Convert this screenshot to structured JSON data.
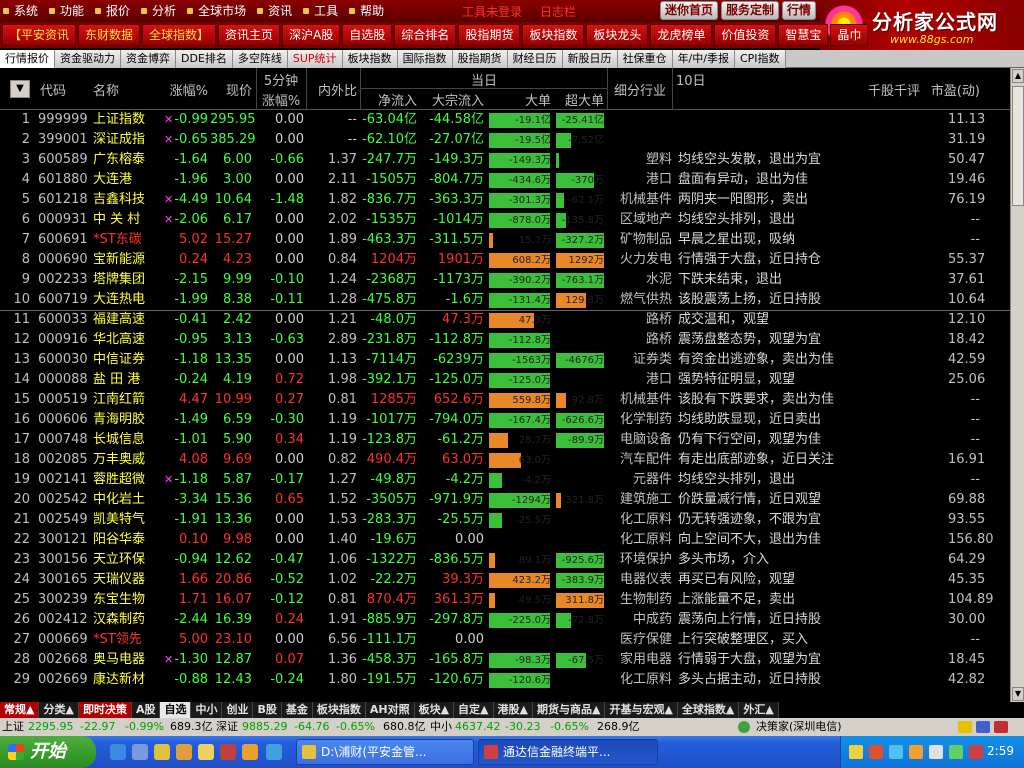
{
  "menu": {
    "items": [
      "系统",
      "功能",
      "报价",
      "分析",
      "全球市场",
      "资讯",
      "工具",
      "帮助"
    ],
    "center_texts": [
      "工具未登录",
      "日志栏"
    ],
    "right_buttons": [
      "迷你首页",
      "服务定制",
      "行情"
    ]
  },
  "logo": {
    "title": "分析家公式网",
    "url": "www.88gs.com"
  },
  "toolbar": [
    "【平安资讯",
    "东财数据",
    "全球指数】",
    "资讯主页",
    "深沪A股",
    "自选股",
    "综合排名",
    "股指期货",
    "板块指数",
    "板块龙头",
    "龙虎榜单",
    "价值投资",
    "智慧宝",
    "晶巾"
  ],
  "tabs": [
    "行情报价",
    "资金驱动力",
    "资金博弈",
    "DDE排名",
    "多空阵线",
    "SUP统计",
    "板块指数",
    "国际指数",
    "股指期货",
    "财经日历",
    "新股日历",
    "社保重仓",
    "年/中/季报",
    "CPI指数"
  ],
  "header": {
    "idx_icon": "▼",
    "code": "代码",
    "name": "名称",
    "chg": "涨幅%",
    "price": "现价",
    "m5_top": "5分钟",
    "m5_bottom": "涨幅%",
    "ratio": "内外比",
    "day": "当日",
    "netin": "净流入",
    "bigin": "大宗流入",
    "big": "大单",
    "superbig": "超大单",
    "industry": "细分行业",
    "tenday": "10日",
    "comment": "千股千评",
    "pe": "市盈(动)"
  },
  "rows": [
    {
      "idx": "1",
      "code": "999999",
      "name": "上证指数",
      "star": true,
      "chg": "-0.99",
      "price": "295.95",
      "m5": "0.00",
      "ratio": "--",
      "netin": "-63.04亿",
      "bigin": "-44.58亿",
      "b1": {
        "v": "-19.1亿",
        "c": "g",
        "w": 0.95
      },
      "b2": {
        "v": "-25.41亿",
        "c": "g",
        "w": 0.95
      },
      "ind": "",
      "comment": "",
      "pe": "11.13",
      "cc": "d"
    },
    {
      "idx": "2",
      "code": "399001",
      "name": "深证成指",
      "star": true,
      "chg": "-0.65",
      "price": "385.29",
      "m5": "0.00",
      "ratio": "--",
      "netin": "-62.10亿",
      "bigin": "-27.07亿",
      "b1": {
        "v": "-19.5亿",
        "c": "g",
        "w": 0.95
      },
      "b2": {
        "v": "-7.52亿",
        "c": "g",
        "w": 0.3
      },
      "ind": "",
      "comment": "",
      "pe": "31.19",
      "cc": "d"
    },
    {
      "idx": "3",
      "code": "600589",
      "name": "广东榕泰",
      "chg": "-1.64",
      "price": "6.00",
      "m5": "-0.66",
      "ratio": "1.37",
      "netin": "-247.7万",
      "bigin": "-149.3万",
      "b1": {
        "v": "-149.3万",
        "c": "g",
        "w": 0.95
      },
      "b2": {
        "v": "",
        "c": "g",
        "w": 0.05
      },
      "ind": "塑料",
      "comment": "均线空头发散，退出为宜",
      "pe": "50.47",
      "cc": "d"
    },
    {
      "idx": "4",
      "code": "601880",
      "name": "大连港",
      "chg": "-1.96",
      "price": "3.00",
      "m5": "0.00",
      "ratio": "2.11",
      "netin": "-1505万",
      "bigin": "-804.7万",
      "b1": {
        "v": "-434.6万",
        "c": "g",
        "w": 0.95
      },
      "b2": {
        "v": "-370万",
        "c": "g",
        "w": 0.75
      },
      "ind": "港口",
      "comment": "盘面有异动，退出为佳",
      "pe": "19.46",
      "cc": "d"
    },
    {
      "idx": "5",
      "code": "601218",
      "name": "吉鑫科技",
      "star": true,
      "chg": "-4.49",
      "price": "10.64",
      "m5": "-1.48",
      "ratio": "1.82",
      "netin": "-836.7万",
      "bigin": "-363.3万",
      "b1": {
        "v": "-301.3万",
        "c": "g",
        "w": 0.95
      },
      "b2": {
        "v": "-62.1万",
        "c": "g",
        "w": 0.15
      },
      "ind": "机械基件",
      "comment": "两阴夹一阳图形，卖出",
      "pe": "76.19",
      "cc": "d"
    },
    {
      "idx": "6",
      "code": "000931",
      "name": "中 关 村",
      "star": true,
      "chg": "-2.06",
      "price": "6.17",
      "m5": "0.00",
      "ratio": "2.02",
      "netin": "-1535万",
      "bigin": "-1014万",
      "b1": {
        "v": "-878.0万",
        "c": "g",
        "w": 0.95
      },
      "b2": {
        "v": "-135.8万",
        "c": "g",
        "w": 0.2
      },
      "ind": "区域地产",
      "comment": "均线空头排列，退出",
      "pe": "--",
      "cc": "d"
    },
    {
      "idx": "7",
      "code": "600691",
      "name": "*ST东碳",
      "red": true,
      "chg": "5.02",
      "price": "15.27",
      "m5": "0.00",
      "ratio": "1.89",
      "netin": "-463.3万",
      "bigin": "-311.5万",
      "b1": {
        "v": "15.7万",
        "c": "o",
        "w": 0.06
      },
      "b2": {
        "v": "-327.2万",
        "c": "g",
        "w": 0.95
      },
      "ind": "矿物制品",
      "comment": "早晨之星出现，吸纳",
      "pe": "--",
      "cc": "u"
    },
    {
      "idx": "8",
      "code": "000690",
      "name": "宝新能源",
      "chg": "0.24",
      "price": "4.23",
      "m5": "0.00",
      "ratio": "0.84",
      "netin": "1204万",
      "bigin": "1901万",
      "b1": {
        "v": "608.2万",
        "c": "o",
        "w": 0.95
      },
      "b2": {
        "v": "1292万",
        "c": "o",
        "w": 0.95
      },
      "ind": "火力发电",
      "comment": "行情强于大盘，近日持仓",
      "pe": "55.37",
      "cc": "u"
    },
    {
      "idx": "9",
      "code": "002233",
      "name": "塔牌集团",
      "chg": "-2.15",
      "price": "9.99",
      "m5": "-0.10",
      "ratio": "1.24",
      "netin": "-2368万",
      "bigin": "-1173万",
      "b1": {
        "v": "-390.2万",
        "c": "g",
        "w": 0.95
      },
      "b2": {
        "v": "-763.1万",
        "c": "g",
        "w": 0.95
      },
      "ind": "水泥",
      "comment": "下跌未结束，退出",
      "pe": "37.61",
      "cc": "d"
    },
    {
      "idx": "10",
      "code": "600719",
      "name": "大连热电",
      "chg": "-1.99",
      "price": "8.38",
      "m5": "-0.11",
      "ratio": "1.28",
      "netin": "-475.8万",
      "bigin": "-1.6万",
      "b1": {
        "v": "-131.4万",
        "c": "g",
        "w": 0.95
      },
      "b2": {
        "v": "129.8万",
        "c": "o",
        "w": 0.6
      },
      "ind": "燃气供热",
      "comment": "该股震荡上扬，近日持股",
      "pe": "10.64",
      "cc": "d"
    },
    {
      "idx": "11",
      "code": "600033",
      "name": "福建高速",
      "chg": "-0.41",
      "price": "2.42",
      "m5": "0.00",
      "ratio": "1.21",
      "netin": "-48.0万",
      "bigin": "47.3万",
      "b1": {
        "v": "47.3万",
        "c": "o",
        "w": 0.7
      },
      "b2": {
        "v": "",
        "c": "g",
        "w": 0
      },
      "ind": "路桥",
      "comment": "成交温和，观望",
      "pe": "12.10",
      "cc": "d"
    },
    {
      "idx": "12",
      "code": "000916",
      "name": "华北高速",
      "chg": "-0.95",
      "price": "3.13",
      "m5": "-0.63",
      "ratio": "2.89",
      "netin": "-231.8万",
      "bigin": "-112.8万",
      "b1": {
        "v": "-112.8万",
        "c": "g",
        "w": 0.95
      },
      "b2": {
        "v": "",
        "c": "g",
        "w": 0
      },
      "ind": "路桥",
      "comment": "震荡盘整态势，观望为宜",
      "pe": "18.42",
      "cc": "d"
    },
    {
      "idx": "13",
      "code": "600030",
      "name": "中信证券",
      "chg": "-1.18",
      "price": "13.35",
      "m5": "0.00",
      "ratio": "1.13",
      "netin": "-7114万",
      "bigin": "-6239万",
      "b1": {
        "v": "-1563万",
        "c": "g",
        "w": 0.95
      },
      "b2": {
        "v": "-4676万",
        "c": "g",
        "w": 0.95
      },
      "ind": "证券类",
      "comment": "有资金出逃迹象，卖出为佳",
      "pe": "42.59",
      "cc": "d"
    },
    {
      "idx": "14",
      "code": "000088",
      "name": "盐 田 港",
      "chg": "-0.24",
      "price": "4.19",
      "m5": "0.72",
      "ratio": "1.98",
      "netin": "-392.1万",
      "bigin": "-125.0万",
      "b1": {
        "v": "-125.0万",
        "c": "g",
        "w": 0.95
      },
      "b2": {
        "v": "",
        "c": "g",
        "w": 0
      },
      "ind": "港口",
      "comment": "强势特征明显，观望",
      "pe": "25.06",
      "cc": "d",
      "m5c": "u"
    },
    {
      "idx": "15",
      "code": "000519",
      "name": "江南红箭",
      "chg": "4.47",
      "price": "10.99",
      "m5": "0.27",
      "ratio": "0.81",
      "netin": "1285万",
      "bigin": "652.6万",
      "b1": {
        "v": "559.8万",
        "c": "o",
        "w": 0.95
      },
      "b2": {
        "v": "92.8万",
        "c": "o",
        "w": 0.2
      },
      "ind": "机械基件",
      "comment": "该股有下跌要求，卖出为佳",
      "pe": "--",
      "cc": "u",
      "m5c": "u"
    },
    {
      "idx": "16",
      "code": "000606",
      "name": "青海明胶",
      "chg": "-1.49",
      "price": "6.59",
      "m5": "-0.30",
      "ratio": "1.19",
      "netin": "-1017万",
      "bigin": "-794.0万",
      "b1": {
        "v": "-167.4万",
        "c": "g",
        "w": 0.95
      },
      "b2": {
        "v": "-626.6万",
        "c": "g",
        "w": 0.95
      },
      "ind": "化学制药",
      "comment": "均线助跌显现，近日卖出",
      "pe": "--",
      "cc": "d"
    },
    {
      "idx": "17",
      "code": "000748",
      "name": "长城信息",
      "chg": "-1.01",
      "price": "5.90",
      "m5": "0.34",
      "ratio": "1.19",
      "netin": "-123.8万",
      "bigin": "-61.2万",
      "b1": {
        "v": "28.7万",
        "c": "o",
        "w": 0.3
      },
      "b2": {
        "v": "-89.9万",
        "c": "g",
        "w": 0.95
      },
      "ind": "电脑设备",
      "comment": "仍有下行空间，观望为佳",
      "pe": "--",
      "cc": "d",
      "m5c": "u"
    },
    {
      "idx": "18",
      "code": "002085",
      "name": "万丰奥威",
      "chg": "4.08",
      "price": "9.69",
      "m5": "0.00",
      "ratio": "0.82",
      "netin": "490.4万",
      "bigin": "63.0万",
      "b1": {
        "v": "63.0万",
        "c": "o",
        "w": 0.5
      },
      "b2": {
        "v": "",
        "c": "g",
        "w": 0
      },
      "ind": "汽车配件",
      "comment": "有走出底部迹象，近日关注",
      "pe": "16.91",
      "cc": "u"
    },
    {
      "idx": "19",
      "code": "002141",
      "name": "蓉胜超微",
      "star": true,
      "chg": "-1.18",
      "price": "5.87",
      "m5": "-0.17",
      "ratio": "1.27",
      "netin": "-49.8万",
      "bigin": "-4.2万",
      "b1": {
        "v": "-4.2万",
        "c": "g",
        "w": 0.2
      },
      "b2": {
        "v": "",
        "c": "g",
        "w": 0
      },
      "ind": "元器件",
      "comment": "均线空头排列，退出",
      "pe": "--",
      "cc": "d"
    },
    {
      "idx": "20",
      "code": "002542",
      "name": "中化岩土",
      "chg": "-3.34",
      "price": "15.36",
      "m5": "0.65",
      "ratio": "1.52",
      "netin": "-3505万",
      "bigin": "-971.9万",
      "b1": {
        "v": "-1294万",
        "c": "g",
        "w": 0.95
      },
      "b2": {
        "v": "321.8万",
        "c": "o",
        "w": 0.1
      },
      "ind": "建筑施工",
      "comment": "价跌量减行情，近日观望",
      "pe": "69.88",
      "cc": "d",
      "m5c": "u"
    },
    {
      "idx": "21",
      "code": "002549",
      "name": "凯美特气",
      "chg": "-1.91",
      "price": "13.36",
      "m5": "0.00",
      "ratio": "1.53",
      "netin": "-283.3万",
      "bigin": "-25.5万",
      "b1": {
        "v": "-25.5万",
        "c": "g",
        "w": 0.2
      },
      "b2": {
        "v": "",
        "c": "g",
        "w": 0
      },
      "ind": "化工原料",
      "comment": "仍无转强迹象，不跟为宜",
      "pe": "93.55",
      "cc": "d"
    },
    {
      "idx": "22",
      "code": "300121",
      "name": "阳谷华泰",
      "chg": "0.10",
      "price": "9.98",
      "m5": "0.00",
      "ratio": "1.40",
      "netin": "-19.6万",
      "bigin": "0.00",
      "b1": {
        "v": "",
        "c": "g",
        "w": 0
      },
      "b2": {
        "v": "",
        "c": "g",
        "w": 0
      },
      "ind": "化工原料",
      "comment": "向上空间不大，退出为佳",
      "pe": "156.80",
      "cc": "u"
    },
    {
      "idx": "23",
      "code": "300156",
      "name": "天立环保",
      "chg": "-0.94",
      "price": "12.62",
      "m5": "-0.47",
      "ratio": "1.06",
      "netin": "-1322万",
      "bigin": "-836.5万",
      "b1": {
        "v": "89.1万",
        "c": "o",
        "w": 0.1
      },
      "b2": {
        "v": "-925.6万",
        "c": "g",
        "w": 0.95
      },
      "ind": "环境保护",
      "comment": "多头市场，介入",
      "pe": "64.29",
      "cc": "d"
    },
    {
      "idx": "24",
      "code": "300165",
      "name": "天瑞仪器",
      "chg": "1.66",
      "price": "20.86",
      "m5": "-0.52",
      "ratio": "1.02",
      "netin": "-22.2万",
      "bigin": "39.3万",
      "b1": {
        "v": "423.2万",
        "c": "o",
        "w": 0.95
      },
      "b2": {
        "v": "-383.9万",
        "c": "g",
        "w": 0.95
      },
      "ind": "电器仪表",
      "comment": "再买已有风险，观望",
      "pe": "45.35",
      "cc": "u"
    },
    {
      "idx": "25",
      "code": "300239",
      "name": "东宝生物",
      "chg": "1.71",
      "price": "16.07",
      "m5": "-0.12",
      "ratio": "0.81",
      "netin": "870.4万",
      "bigin": "361.3万",
      "b1": {
        "v": "49.5万",
        "c": "o",
        "w": 0.1
      },
      "b2": {
        "v": "311.8万",
        "c": "o",
        "w": 0.95
      },
      "ind": "生物制药",
      "comment": "上涨能量不足，卖出",
      "pe": "104.89",
      "cc": "u"
    },
    {
      "idx": "26",
      "code": "002412",
      "name": "汉森制药",
      "chg": "-2.44",
      "price": "16.39",
      "m5": "0.24",
      "ratio": "1.91",
      "netin": "-885.9万",
      "bigin": "-297.8万",
      "b1": {
        "v": "-225.0万",
        "c": "g",
        "w": 0.95
      },
      "b2": {
        "v": "-72.8万",
        "c": "g",
        "w": 0.3
      },
      "ind": "中成药",
      "comment": "震荡向上行情，近日持股",
      "pe": "30.00",
      "cc": "d",
      "m5c": "u"
    },
    {
      "idx": "27",
      "code": "000669",
      "name": "*ST领先",
      "red": true,
      "chg": "5.00",
      "price": "23.10",
      "m5": "0.00",
      "ratio": "6.56",
      "netin": "-111.1万",
      "bigin": "0.00",
      "b1": {
        "v": "",
        "c": "g",
        "w": 0
      },
      "b2": {
        "v": "",
        "c": "g",
        "w": 0
      },
      "ind": "医疗保健",
      "comment": "上行突破整理区，买入",
      "pe": "--",
      "cc": "u"
    },
    {
      "idx": "28",
      "code": "002668",
      "name": "奥马电器",
      "star": true,
      "chg": "-1.30",
      "price": "12.87",
      "m5": "0.07",
      "ratio": "1.36",
      "netin": "-458.3万",
      "bigin": "-165.8万",
      "b1": {
        "v": "-98.3万",
        "c": "g",
        "w": 0.95
      },
      "b2": {
        "v": "-67.5万",
        "c": "g",
        "w": 0.6
      },
      "ind": "家用电器",
      "comment": "行情弱于大盘，观望为宜",
      "pe": "18.45",
      "cc": "d",
      "m5c": "u"
    },
    {
      "idx": "29",
      "code": "002669",
      "name": "康达新材",
      "chg": "-0.88",
      "price": "12.43",
      "m5": "-0.24",
      "ratio": "1.80",
      "netin": "-191.5万",
      "bigin": "-120.6万",
      "b1": {
        "v": "-120.6万",
        "c": "g",
        "w": 0.95
      },
      "b2": {
        "v": "",
        "c": "g",
        "w": 0
      },
      "ind": "化工原料",
      "comment": "多头占据主动，近日持股",
      "pe": "42.82",
      "cc": "d"
    }
  ],
  "cattabs": [
    {
      "t": "常规▲",
      "s": "red"
    },
    {
      "t": "分类▲"
    },
    {
      "t": "即时决策",
      "s": "red"
    },
    {
      "t": "A股"
    },
    {
      "t": "自选",
      "s": "white"
    },
    {
      "t": "中小"
    },
    {
      "t": "创业"
    },
    {
      "t": "B股"
    },
    {
      "t": "基金"
    },
    {
      "t": "板块指数"
    },
    {
      "t": "AH对照"
    },
    {
      "t": "板块▲"
    },
    {
      "t": "自定▲"
    },
    {
      "t": "港股▲"
    },
    {
      "t": "期货与商品▲"
    },
    {
      "t": "开基与宏观▲"
    },
    {
      "t": "全球指数▲"
    },
    {
      "t": "外汇▲"
    }
  ],
  "status": {
    "sh_label": "上证",
    "sh_val": "2295.95",
    "sh_chg": "-22.97",
    "sh_pct": "-0.99%",
    "sh_amt": "689.3亿",
    "sz_label": "深证",
    "sz_val": "9885.29",
    "sz_chg": "-64.76",
    "sz_pct": "-0.65%",
    "sz_amt": "680.8亿",
    "zx_label": "中小",
    "zx_val": "4637.42",
    "zx_chg": "-30.23",
    "zx_pct": "-0.65%",
    "zx_amt": "268.9亿",
    "server": "决策家(深圳电信)"
  },
  "taskbar": {
    "start": "开始",
    "windows": [
      "D:\\浦财(平安金管...",
      "通达信金融终端平..."
    ],
    "clock": "2:59"
  },
  "colors": {
    "up": "#ff3030",
    "down": "#40ff40",
    "bar_green": "#3cc03c",
    "bar_orange": "#e88828"
  }
}
